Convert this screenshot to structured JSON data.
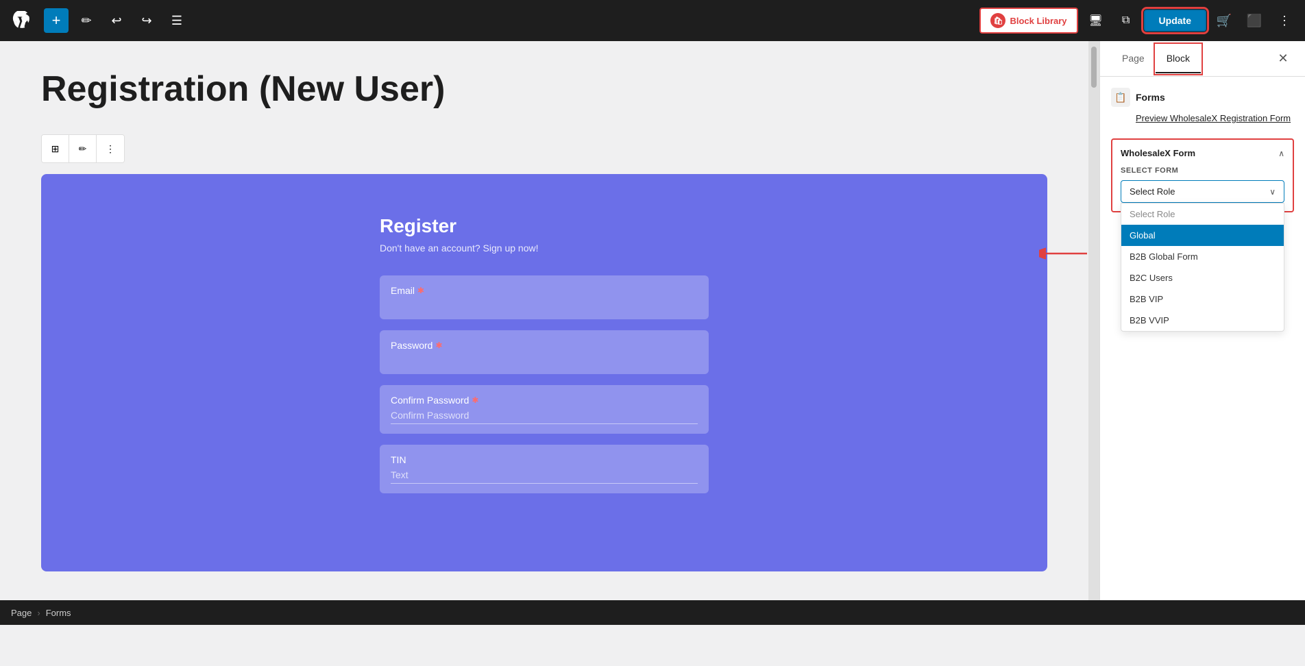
{
  "toolbar": {
    "add_label": "+",
    "pencil_label": "✏",
    "undo_label": "↩",
    "redo_label": "↪",
    "list_label": "☰",
    "block_library_label": "Block Library",
    "update_label": "Update",
    "kebab_label": "⋮"
  },
  "page": {
    "title": "Registration (New User)"
  },
  "block_toolbar": {
    "grid_icon": "⊞",
    "edit_icon": "✏",
    "more_icon": "⋮"
  },
  "registration_form": {
    "title": "Register",
    "subtitle": "Don't have an account? Sign up now!",
    "fields": [
      {
        "label": "Email",
        "required": true,
        "placeholder": ""
      },
      {
        "label": "Password",
        "required": true,
        "placeholder": ""
      },
      {
        "label": "Confirm Password",
        "required": true,
        "placeholder": "Confirm Password"
      },
      {
        "label": "TIN",
        "required": false,
        "placeholder": "Text"
      }
    ]
  },
  "sidebar": {
    "page_tab": "Page",
    "block_tab": "Block",
    "forms_title": "Forms",
    "forms_preview": "Preview WholesaleX Registration Form",
    "wholesalex_form_title": "WholesaleX Form",
    "select_form_label": "SELECT FORM",
    "select_placeholder": "Select Role",
    "dropdown_items": [
      {
        "value": "select_role",
        "label": "Select Role",
        "type": "placeholder"
      },
      {
        "value": "global",
        "label": "Global",
        "type": "selected"
      },
      {
        "value": "b2b_global_form",
        "label": "B2B Global Form",
        "type": "normal"
      },
      {
        "value": "b2c_users",
        "label": "B2C Users",
        "type": "normal"
      },
      {
        "value": "b2b_vip",
        "label": "B2B VIP",
        "type": "normal"
      },
      {
        "value": "b2b_vvip",
        "label": "B2B VVIP",
        "type": "normal"
      }
    ]
  },
  "breadcrumb": {
    "page_label": "Page",
    "separator": "›",
    "forms_label": "Forms"
  }
}
